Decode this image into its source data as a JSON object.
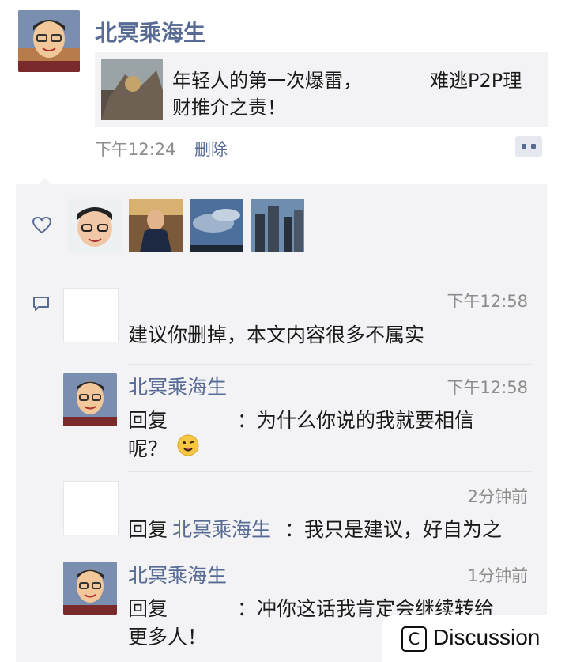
{
  "post": {
    "author": "北冥乘海生",
    "link_title_line1": "年轻人的第一次爆雷，",
    "link_title_line1b": "难逃P2P理",
    "link_title_line2": "财推介之责！",
    "time": "下午12:24",
    "delete_label": "删除"
  },
  "comments": [
    {
      "author": "",
      "time": "下午12:58",
      "text": "建议你删掉，本文内容很多不属实"
    },
    {
      "author": "北冥乘海生",
      "time": "下午12:58",
      "reply_word": "回复",
      "text_line1": "：为什么你说的我就要相信",
      "text_line2": "呢？"
    },
    {
      "author": "",
      "time": "2分钟前",
      "reply_word": "回复",
      "reply_target": "北冥乘海生",
      "text": "：我只是建议，好自为之"
    },
    {
      "author": "北冥乘海生",
      "time": "1分钟前",
      "reply_word": "回复",
      "text_line1": "：冲你这话我肯定会继续转给",
      "text_line2": "更多人！"
    }
  ],
  "watermark": {
    "symbol": "C",
    "text": "Discussion"
  }
}
